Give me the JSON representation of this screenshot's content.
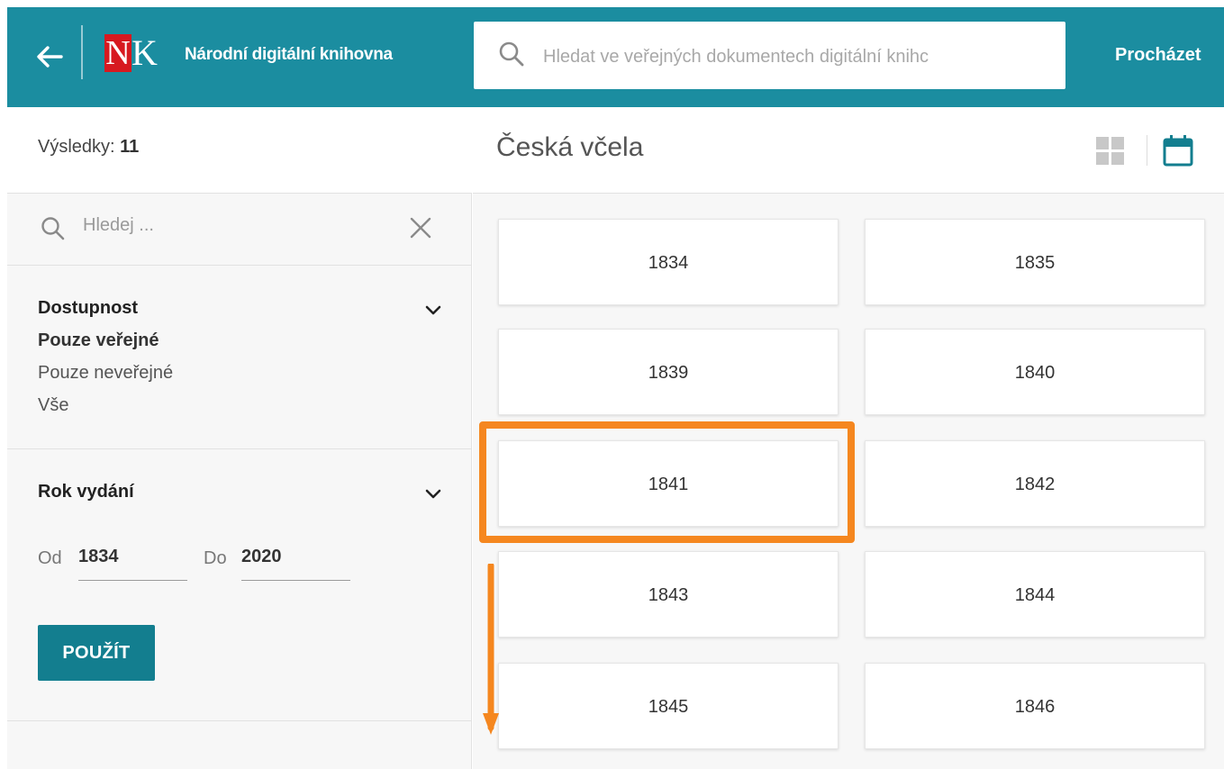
{
  "header": {
    "logo_n": "N",
    "logo_k": "K",
    "site_title": "Národní digitální knihovna",
    "search_placeholder": "Hledat ve veřejných dokumentech digitální knihc",
    "browse_label": "Procházet",
    "bg_color": "#1b8da0"
  },
  "sidebar": {
    "results_label": "Výsledky:",
    "results_count": "11",
    "filter_placeholder": "Hledej ...",
    "availability": {
      "title": "Dostupnost",
      "options": [
        {
          "label": "Pouze veřejné",
          "selected": true
        },
        {
          "label": "Pouze neveřejné",
          "selected": false
        },
        {
          "label": "Vše",
          "selected": false
        }
      ]
    },
    "year_filter": {
      "title": "Rok vydání",
      "from_label": "Od",
      "from_value": "1834",
      "to_label": "Do",
      "to_value": "2020",
      "apply_label": "POUŽÍT"
    }
  },
  "main": {
    "title": "Česká včela",
    "years": [
      "1834",
      "1835",
      "1839",
      "1840",
      "1841",
      "1842",
      "1843",
      "1844",
      "1845",
      "1846"
    ],
    "highlighted_year": "1841"
  },
  "colors": {
    "accent": "#1b8da0",
    "button": "#137e8f",
    "annotation": "#f5871f"
  },
  "icons": [
    "back-arrow-icon",
    "search-icon",
    "close-icon",
    "chevron-down-icon",
    "grid-view-icon",
    "calendar-icon"
  ]
}
